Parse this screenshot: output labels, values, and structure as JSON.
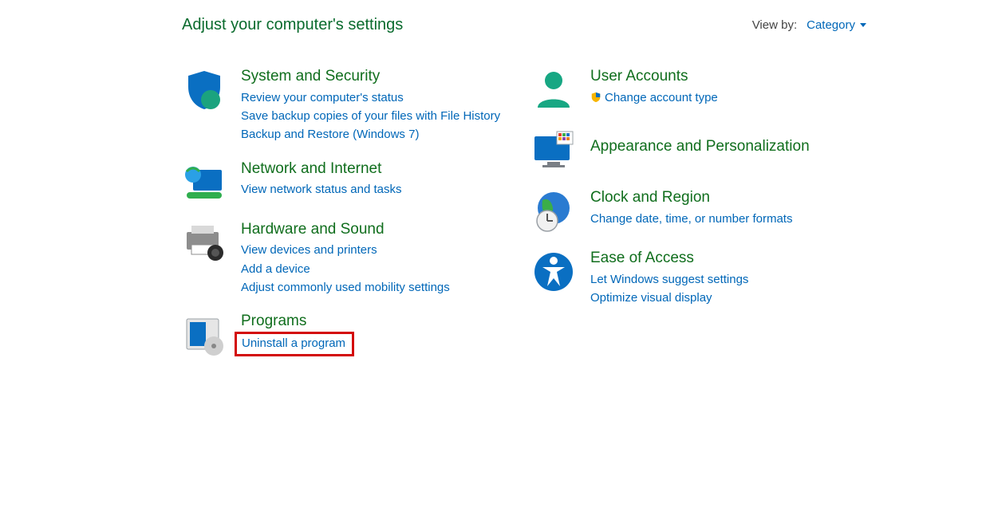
{
  "header": {
    "title": "Adjust your computer's settings",
    "view_by_label": "View by:",
    "view_by_value": "Category"
  },
  "left": {
    "system_security": {
      "title": "System and Security",
      "links": [
        "Review your computer's status",
        "Save backup copies of your files with File History",
        "Backup and Restore (Windows 7)"
      ]
    },
    "network": {
      "title": "Network and Internet",
      "link": "View network status and tasks"
    },
    "hardware": {
      "title": "Hardware and Sound",
      "links": [
        "View devices and printers",
        "Add a device",
        "Adjust commonly used mobility settings"
      ]
    },
    "programs": {
      "title": "Programs",
      "link": "Uninstall a program"
    }
  },
  "right": {
    "accounts": {
      "title": "User Accounts",
      "link": "Change account type"
    },
    "appearance": {
      "title": "Appearance and Personalization"
    },
    "clock": {
      "title": "Clock and Region",
      "link": "Change date, time, or number formats"
    },
    "ease": {
      "title": "Ease of Access",
      "links": [
        "Let Windows suggest settings",
        "Optimize visual display"
      ]
    }
  }
}
